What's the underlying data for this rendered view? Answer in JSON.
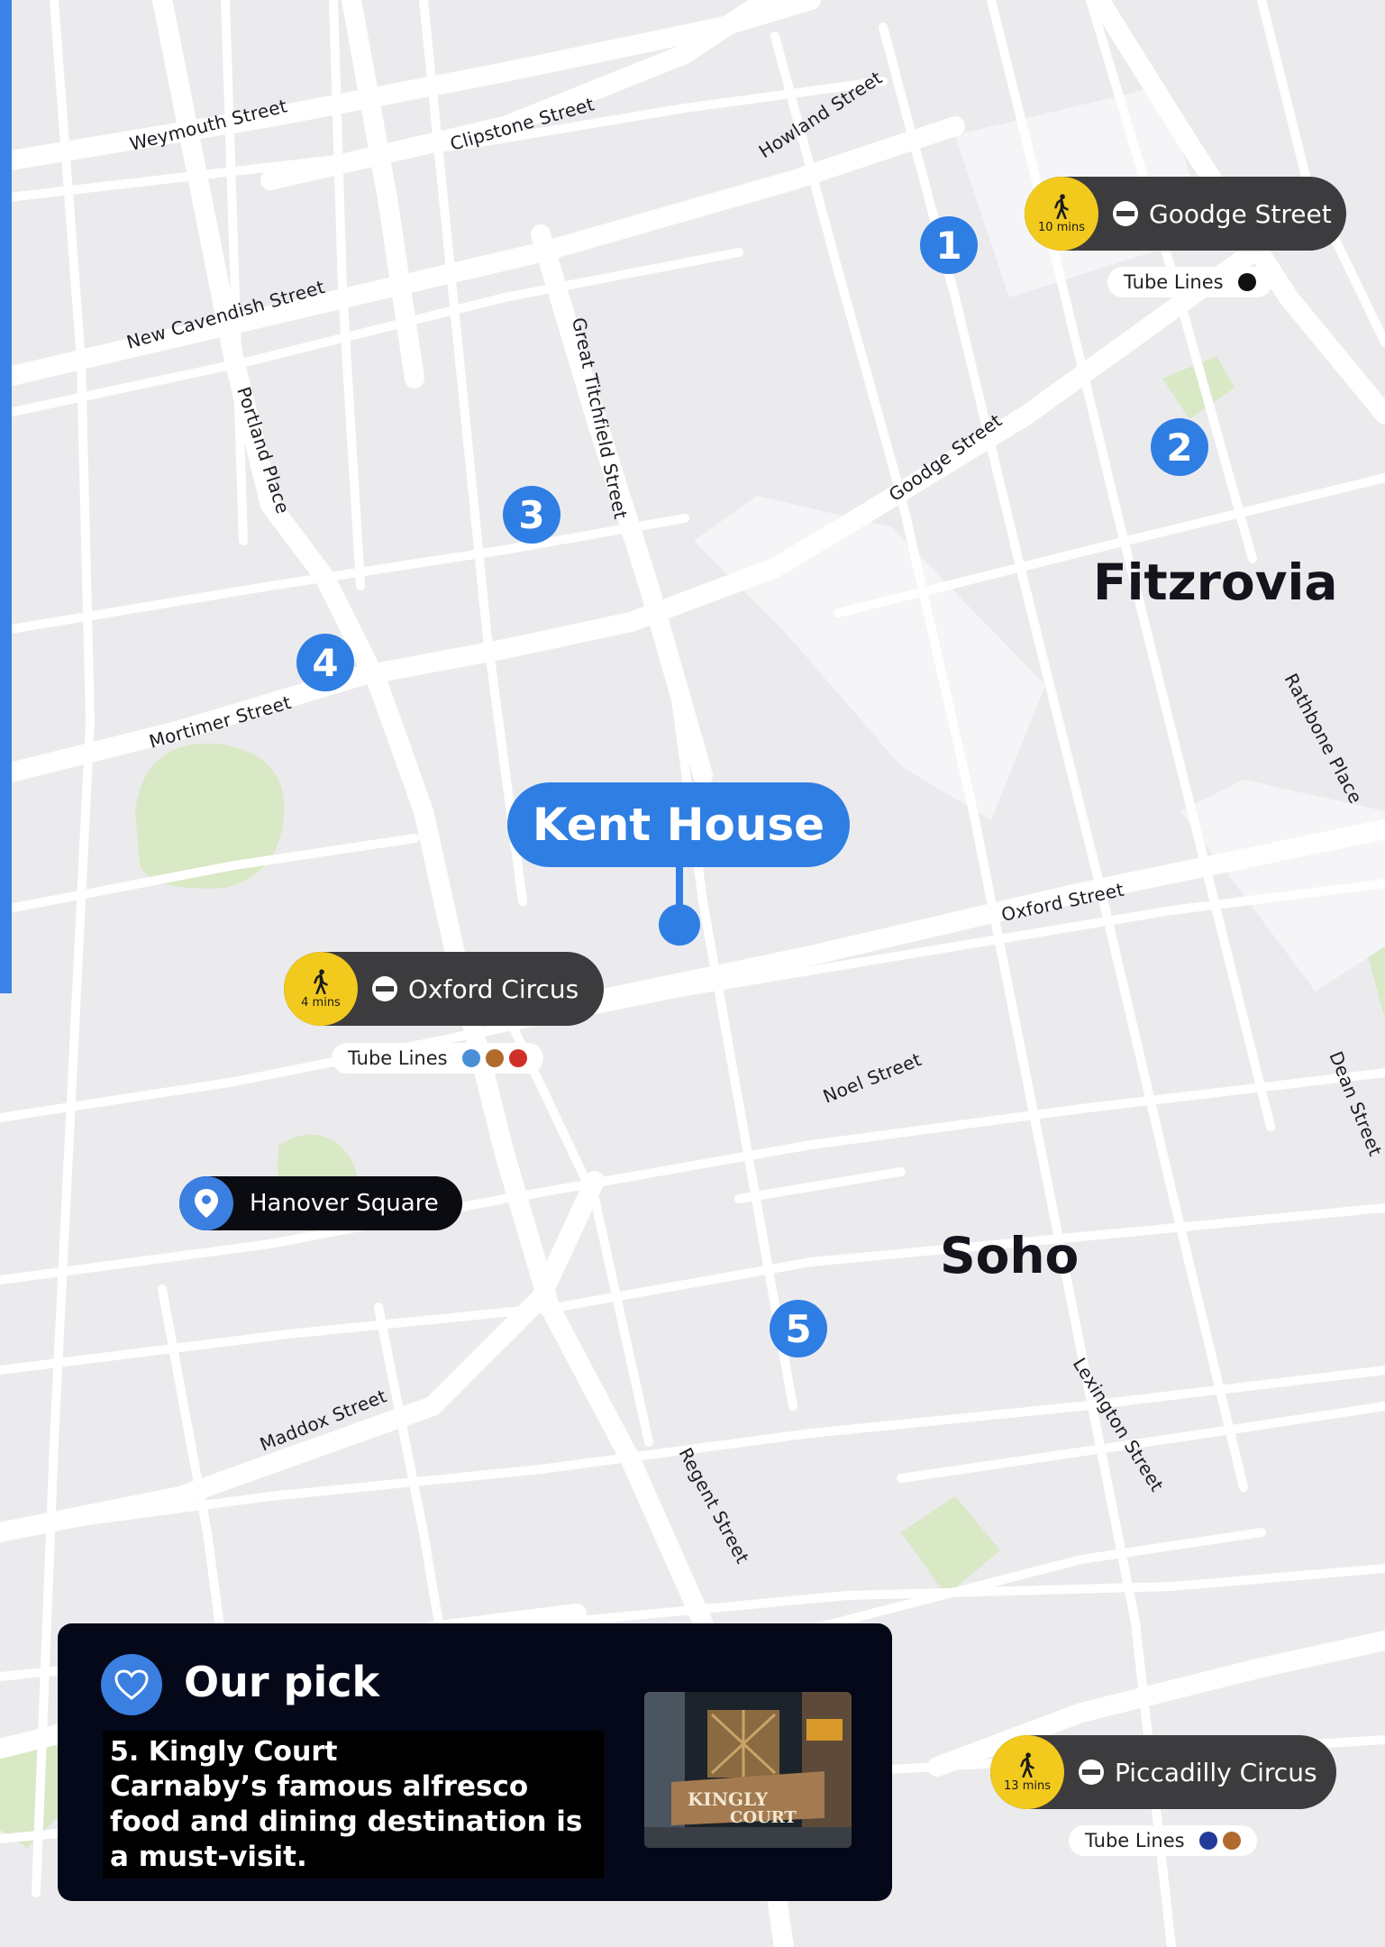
{
  "map": {
    "areas": [
      "Fitzrovia",
      "Soho"
    ],
    "streets": [
      "Weymouth Street",
      "Clipstone Street",
      "Howland Street",
      "New Cavendish Street",
      "Portland Place",
      "Great Titchfield Street",
      "Goodge Street",
      "Mortimer Street",
      "Rathbone Place",
      "Oxford Street",
      "Noel Street",
      "Dean Street",
      "Maddox Street",
      "Regent Street",
      "Lexington Street"
    ],
    "markers": [
      "1",
      "2",
      "3",
      "4",
      "5"
    ],
    "colors": {
      "land": "#ebebee",
      "road": "#ffffff",
      "park": "#d9e8c5",
      "accent": "#2f7ee3",
      "walk_badge": "#f2c91d"
    }
  },
  "destination": {
    "label": "Kent House"
  },
  "stations": [
    {
      "name": "Goodge Street",
      "walk": "10 mins",
      "tube_lines_label": "Tube Lines",
      "line_colors": [
        "#111111"
      ]
    },
    {
      "name": "Oxford Circus",
      "walk": "4 mins",
      "tube_lines_label": "Tube Lines",
      "line_colors": [
        "#4a8fd6",
        "#b06a2b",
        "#d0302a"
      ]
    },
    {
      "name": "Piccadilly Circus",
      "walk": "13 mins",
      "tube_lines_label": "Tube Lines",
      "line_colors": [
        "#243a9a",
        "#b06a2b"
      ]
    }
  ],
  "place": {
    "name": "Hanover Square",
    "icon": "location-pin-icon"
  },
  "our_pick": {
    "title": "Our pick",
    "icon": "heart-icon",
    "place_name": "5. Kingly Court",
    "description": "Carnaby’s famous alfresco food and dining destination is a must-visit.",
    "photo_sign": [
      "KINGLY",
      "COURT"
    ]
  }
}
